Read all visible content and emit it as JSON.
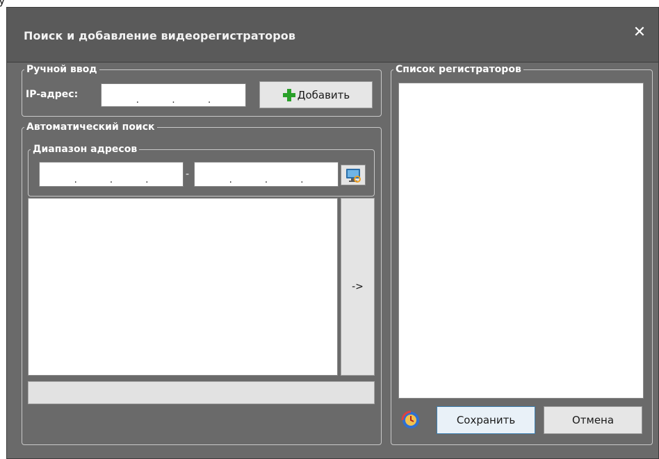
{
  "window": {
    "title": "Поиск и добавление видеорегистраторов",
    "close_glyph": "✕"
  },
  "manual": {
    "legend": "Ручной ввод",
    "ip_label": "IP-адрес:",
    "ip_value": ". . .",
    "add_button_label": "Добавить",
    "add_icon": "plus-icon"
  },
  "auto_search": {
    "legend": "Автоматический поиск",
    "range_legend": "Диапазон адресов",
    "range_separator": "-",
    "scan_icon": "monitor-scan-icon",
    "transfer_label": "->"
  },
  "registrars": {
    "legend": "Список регистраторов",
    "refresh_icon": "refresh-clock-icon",
    "save_label": "Сохранить",
    "cancel_label": "Отмена"
  },
  "colors": {
    "window_bg": "#6a6a6a",
    "titlebar_bg": "#5a5a5a",
    "accent_plus": "#2aa02a"
  }
}
